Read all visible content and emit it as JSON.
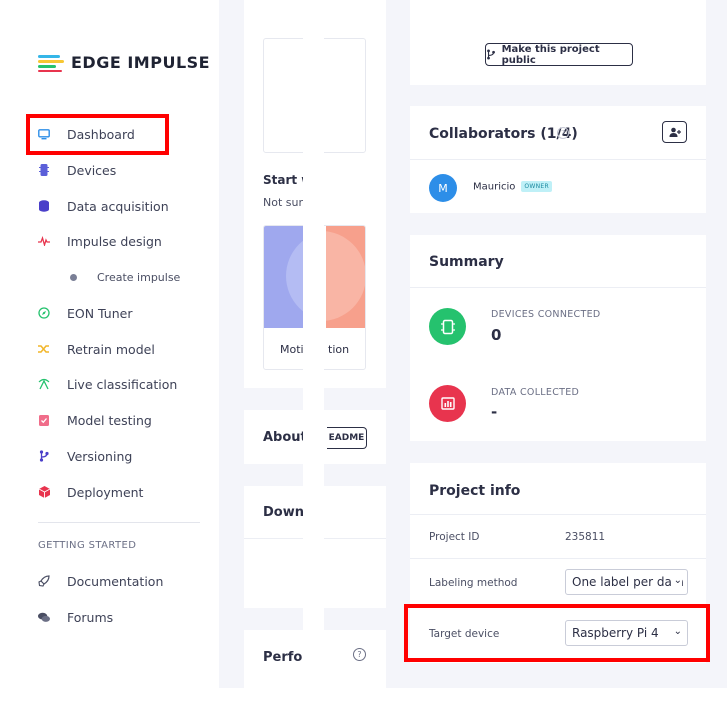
{
  "app": {
    "logo_text": "EDGE IMPULSE"
  },
  "sidebar": {
    "items": [
      {
        "label": "Dashboard",
        "icon": "monitor-icon"
      },
      {
        "label": "Devices",
        "icon": "chip-icon"
      },
      {
        "label": "Data acquisition",
        "icon": "database-icon"
      },
      {
        "label": "Impulse design",
        "icon": "pulse-icon"
      },
      {
        "label": "Create impulse",
        "icon": "dot-icon"
      },
      {
        "label": "EON Tuner",
        "icon": "compass-icon"
      },
      {
        "label": "Retrain model",
        "icon": "shuffle-icon"
      },
      {
        "label": "Live classification",
        "icon": "radar-icon"
      },
      {
        "label": "Model testing",
        "icon": "clipboard-check-icon"
      },
      {
        "label": "Versioning",
        "icon": "branch-icon"
      },
      {
        "label": "Deployment",
        "icon": "package-icon"
      }
    ],
    "section_label": "GETTING STARTED",
    "getting_started": [
      {
        "label": "Documentation",
        "icon": "rocket-icon"
      },
      {
        "label": "Forums",
        "icon": "chat-icon"
      }
    ]
  },
  "main_left": {
    "start_title": "Start w",
    "start_sub": "Not sur",
    "motion_left": "Moti",
    "motion_right": "tion",
    "about_title": "About",
    "readme_label": "EADME",
    "download_title": "Downl",
    "performance_title": "Perfor"
  },
  "public_card": {
    "button_label": "Make this project public"
  },
  "collaborators": {
    "title": "Collaborators (1/4)",
    "members": [
      {
        "initial": "M",
        "name": "Mauricio",
        "badge": "OWNER"
      }
    ]
  },
  "summary": {
    "title": "Summary",
    "devices_label": "DEVICES CONNECTED",
    "devices_value": "0",
    "data_label": "DATA COLLECTED",
    "data_value": "-"
  },
  "project_info": {
    "title": "Project info",
    "project_id_label": "Project ID",
    "project_id_value": "235811",
    "labeling_label": "Labeling method",
    "labeling_value": "One label per data i",
    "target_label": "Target device",
    "target_value": "Raspberry Pi 4"
  },
  "colors": {
    "accent_red": "#ff0000",
    "devices_green": "#25c26e",
    "data_red": "#e8344e",
    "avatar_blue": "#2d8ee8",
    "motion_blue": "#9fa8ee",
    "motion_salmon": "#f7a08c"
  }
}
